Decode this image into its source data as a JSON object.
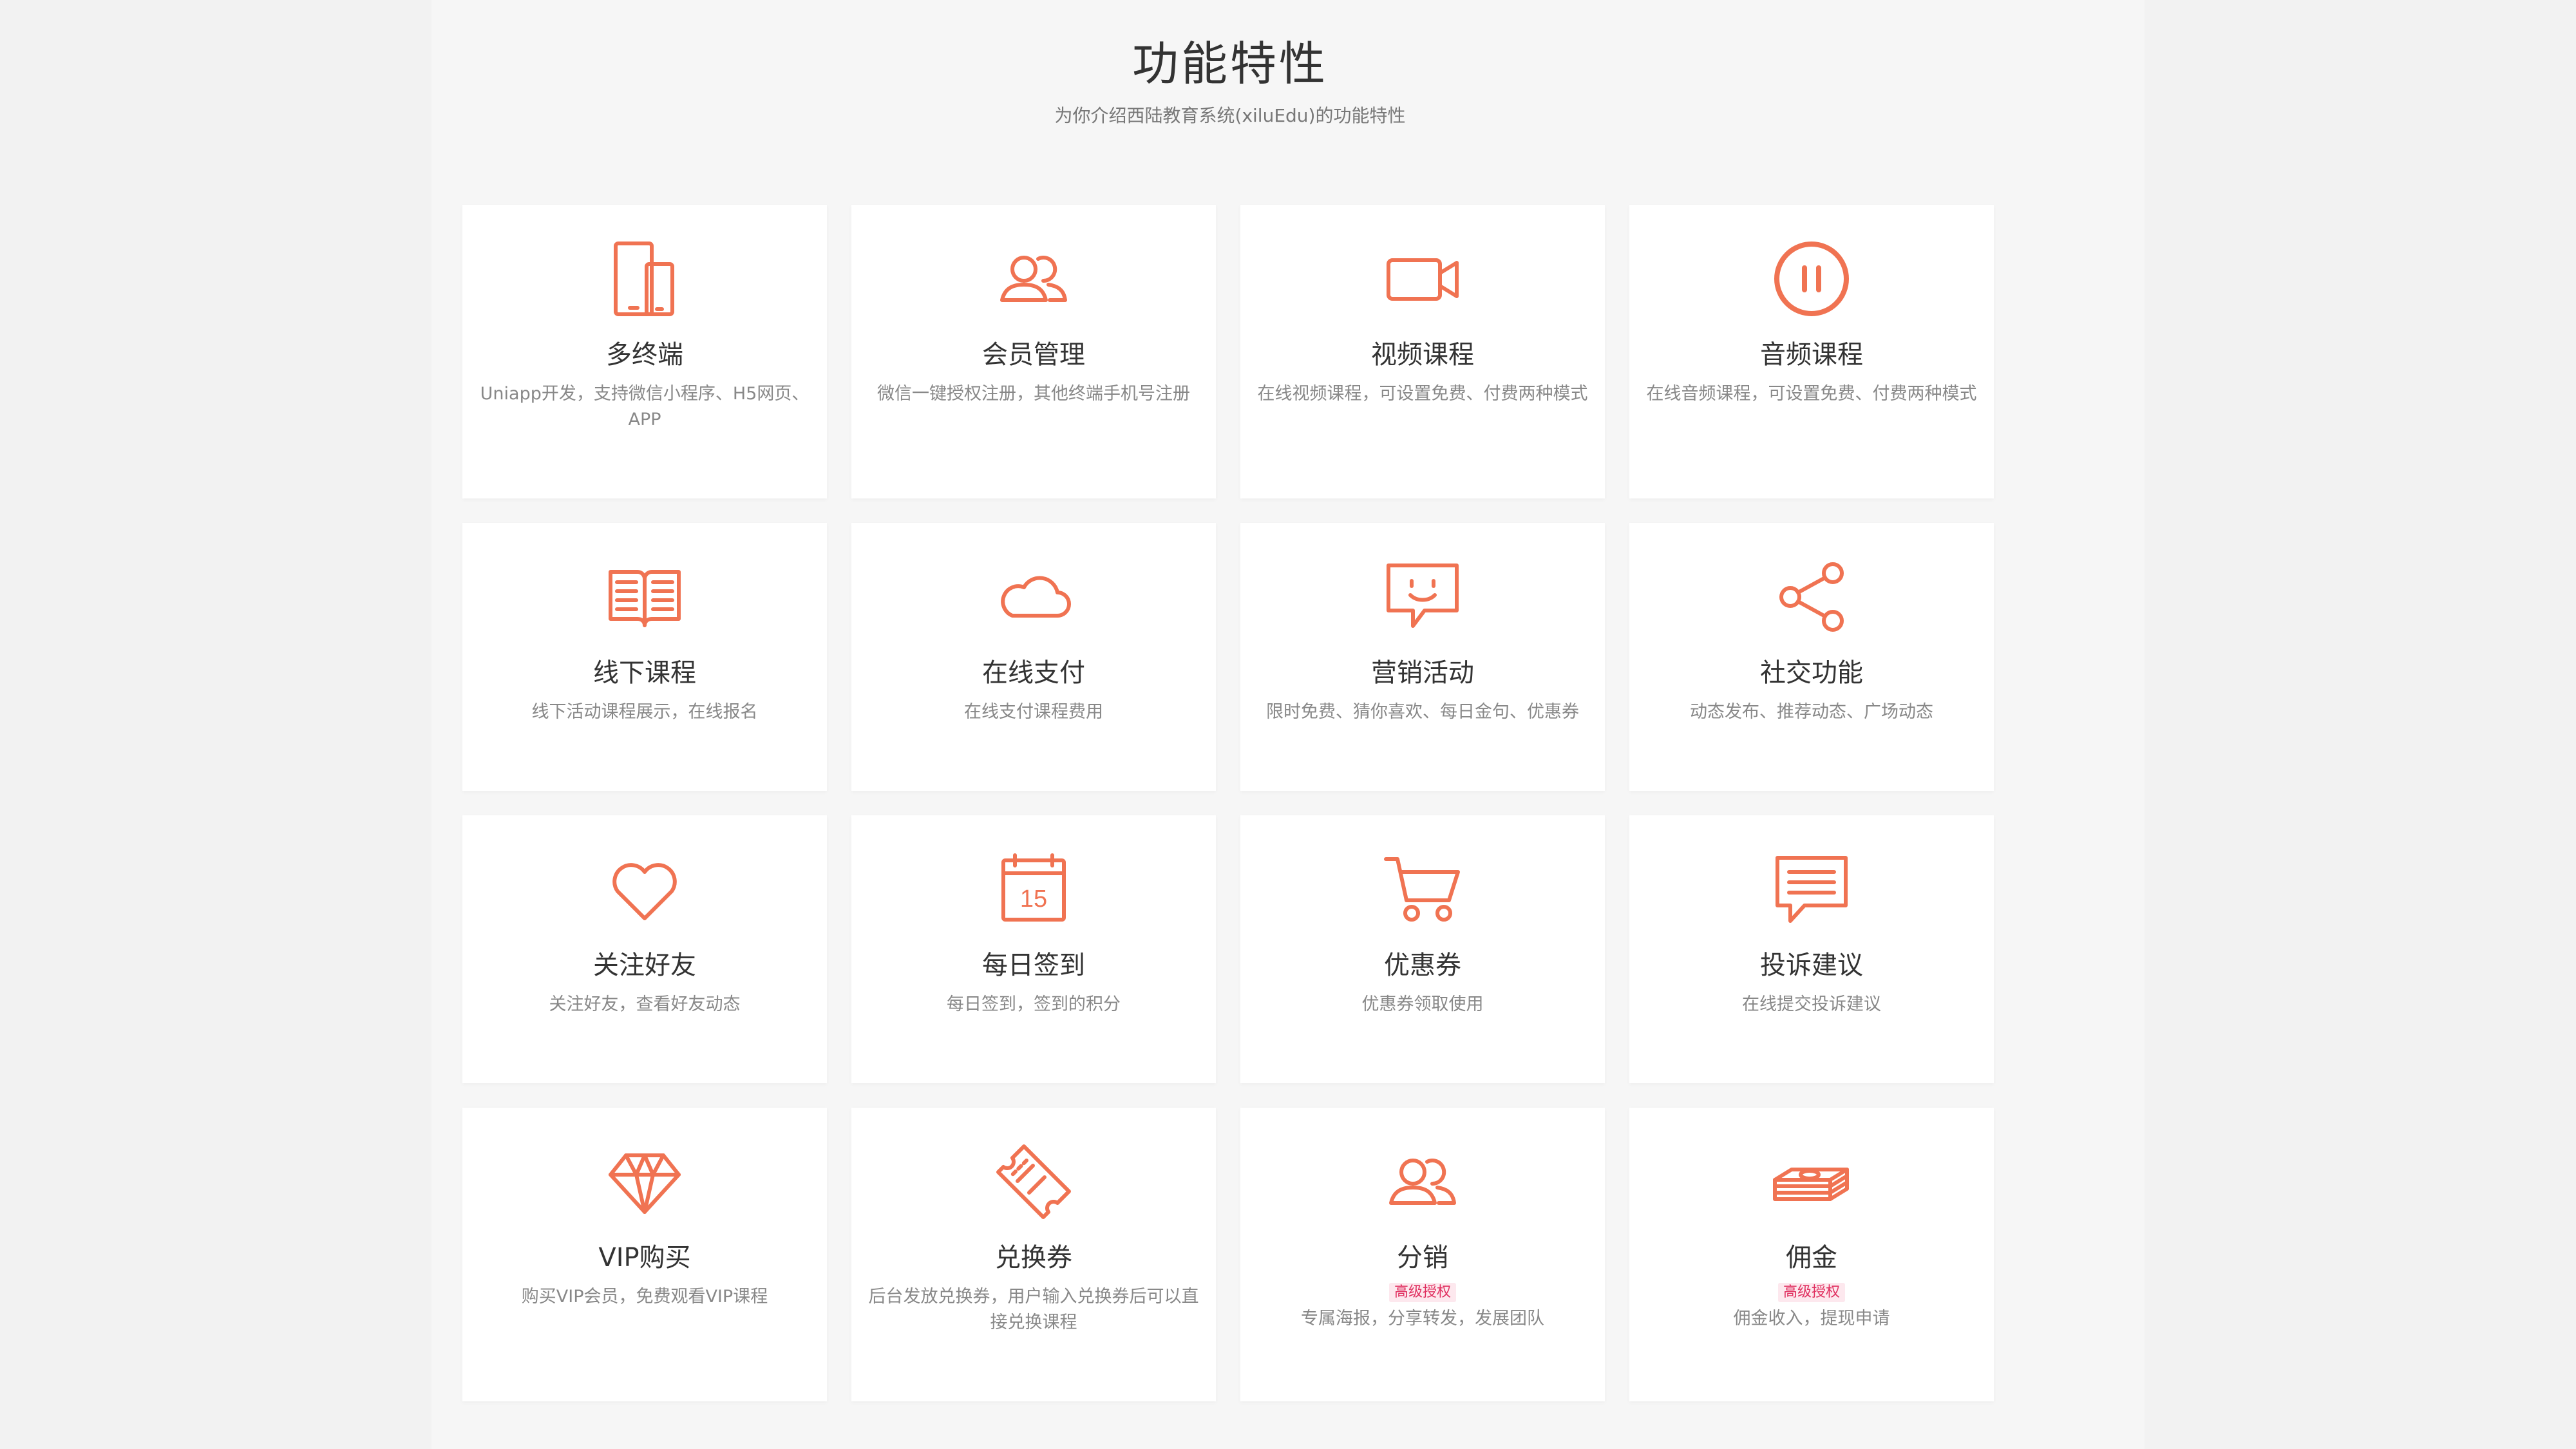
{
  "header": {
    "title": "功能特性",
    "subtitle": "为你介绍西陆教育系统(xiluEdu)的功能特性"
  },
  "accent_color": "#f07352",
  "badge_color": "#e03060",
  "features": [
    {
      "icon": "devices-icon",
      "title": "多终端",
      "desc": "Uniapp开发，支持微信小程序、H5网页、APP"
    },
    {
      "icon": "members-icon",
      "title": "会员管理",
      "desc": "微信一键授权注册，其他终端手机号注册"
    },
    {
      "icon": "video-camera-icon",
      "title": "视频课程",
      "desc": "在线视频课程，可设置免费、付费两种模式"
    },
    {
      "icon": "pause-circle-icon",
      "title": "音频课程",
      "desc": "在线音频课程，可设置免费、付费两种模式"
    },
    {
      "icon": "open-book-icon",
      "title": "线下课程",
      "desc": "线下活动课程展示，在线报名"
    },
    {
      "icon": "cloud-icon",
      "title": "在线支付",
      "desc": "在线支付课程费用"
    },
    {
      "icon": "smiley-chat-icon",
      "title": "营销活动",
      "desc": "限时免费、猜你喜欢、每日金句、优惠券"
    },
    {
      "icon": "share-icon",
      "title": "社交功能",
      "desc": "动态发布、推荐动态、广场动态"
    },
    {
      "icon": "heart-icon",
      "title": "关注好友",
      "desc": "关注好友，查看好友动态"
    },
    {
      "icon": "calendar-icon",
      "title": "每日签到",
      "desc": "每日签到，签到的积分",
      "calendar_day": "15"
    },
    {
      "icon": "shopping-cart-icon",
      "title": "优惠券",
      "desc": "优惠券领取使用"
    },
    {
      "icon": "message-icon",
      "title": "投诉建议",
      "desc": "在线提交投诉建议"
    },
    {
      "icon": "diamond-icon",
      "title": "VIP购买",
      "desc": "购买VIP会员，免费观看VIP课程"
    },
    {
      "icon": "ticket-icon",
      "title": "兑换券",
      "desc": "后台发放兑换券，用户输入兑换券后可以直接兑换课程"
    },
    {
      "icon": "members-icon",
      "title": "分销",
      "badge": "高级授权",
      "desc": "专属海报，分享转发，发展团队"
    },
    {
      "icon": "money-stack-icon",
      "title": "佣金",
      "badge": "高级授权",
      "desc": "佣金收入，提现申请"
    }
  ]
}
